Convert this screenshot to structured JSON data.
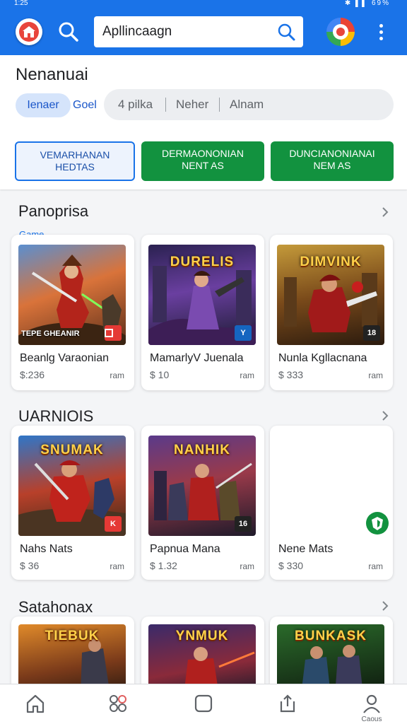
{
  "status_bar": {
    "time": "1:25",
    "icons_text": "✱ ▌▌ 69%"
  },
  "app_bar": {
    "search_value": "Apllincaagn",
    "icons": [
      "home-icon",
      "search-icon",
      "avatar",
      "more-vert-icon"
    ],
    "accent": "#1a73e8"
  },
  "header": {
    "title": "Nenanuai",
    "chip_label": "Ienaer",
    "chip_side_label": "Goel",
    "segments": [
      "4 pilka",
      "Neher",
      "Alnam"
    ],
    "buttons": [
      {
        "line1": "VEMARHANAN",
        "line2": "HEDTAS",
        "style": "outline"
      },
      {
        "line1": "DERMAONONIAN",
        "line2": "NENT AS",
        "style": "filled"
      },
      {
        "line1": "DUNCIANONIANAI",
        "line2": "NEM AS",
        "style": "filled"
      }
    ],
    "button_green": "#12923f"
  },
  "sections": [
    {
      "title": "Panoprisa",
      "subtitle": "Game",
      "cards": [
        {
          "name": "Beanlg Varaonian",
          "price": "$:236",
          "unit": "ram",
          "art_title": "",
          "art_footer": "TEPE GHEANIR",
          "badge": "",
          "badge_color": "#e53935"
        },
        {
          "name": "MamarlyV Juenala",
          "price": "$ 10",
          "unit": "ram",
          "art_title": "DURELIS",
          "art_footer": "",
          "badge": "Y",
          "badge_color": "#1565c0"
        },
        {
          "name": "Nunla Kgllacnana",
          "price": "$ 333",
          "unit": "ram",
          "art_title": "DIMVINK",
          "art_footer": "",
          "badge": "18",
          "badge_color": "#222222"
        }
      ]
    },
    {
      "title": "UARNIOIS",
      "subtitle": "",
      "cards": [
        {
          "name": "Nahs Nats",
          "price": "$ 36",
          "unit": "ram",
          "art_title": "SNUMAK",
          "art_footer": "",
          "badge": "K",
          "badge_color": "#e53935"
        },
        {
          "name": "Papnua Mana",
          "price": "$ 1.32",
          "unit": "ram",
          "art_title": "NANHIK",
          "art_footer": "",
          "badge": "16",
          "badge_color": "#222222"
        },
        {
          "name": "Nene Mats",
          "price": "$ 330",
          "unit": "ram",
          "art_title": "",
          "art_footer": "",
          "badge": "",
          "badge_color": "#12923f"
        }
      ]
    },
    {
      "title": "Satahonax",
      "subtitle": "",
      "cards": [
        {
          "art_title": "TIEBUK"
        },
        {
          "art_title": "YNMUK"
        },
        {
          "art_title": "BUNKASK"
        }
      ]
    }
  ],
  "bottom_nav": {
    "items": [
      {
        "icon": "home-icon",
        "label": ""
      },
      {
        "icon": "apps-icon",
        "label": ""
      },
      {
        "icon": "square-icon",
        "label": ""
      },
      {
        "icon": "share-icon",
        "label": ""
      },
      {
        "icon": "person-icon",
        "label": "Caous"
      }
    ]
  }
}
